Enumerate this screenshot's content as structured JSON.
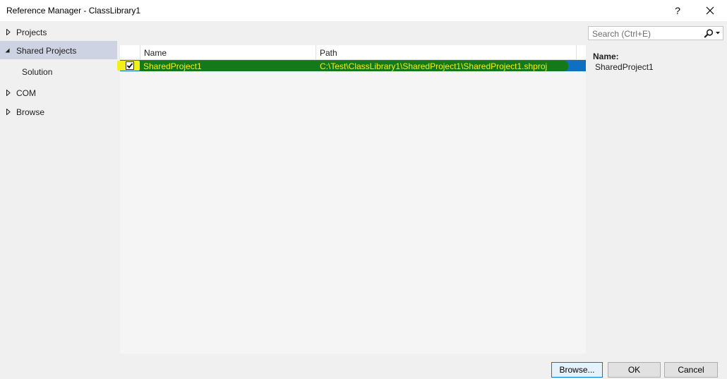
{
  "window": {
    "title": "Reference Manager - ClassLibrary1",
    "help_label": "?"
  },
  "sidebar": {
    "items": [
      {
        "label": "Projects",
        "expanded": false
      },
      {
        "label": "Shared Projects",
        "expanded": true,
        "selected": true
      },
      {
        "label": "Solution"
      },
      {
        "label": "COM",
        "expanded": false
      },
      {
        "label": "Browse",
        "expanded": false
      }
    ]
  },
  "search": {
    "placeholder": "Search (Ctrl+E)"
  },
  "table": {
    "columns": [
      "Name",
      "Path"
    ],
    "rows": [
      {
        "checked": true,
        "name": "SharedProject1",
        "path": "C:\\Test\\ClassLibrary1\\SharedProject1\\SharedProject1.shproj"
      }
    ]
  },
  "details": {
    "label": "Name:",
    "value": "SharedProject1"
  },
  "buttons": {
    "browse": "Browse...",
    "ok": "OK",
    "cancel": "Cancel"
  },
  "colors": {
    "selection": "#0e70c0",
    "highlight_green": "#137a0b",
    "highlight_yellow": "#f2ef1a",
    "nav_selected": "#cdd3e2",
    "primary_border": "#0078d7"
  }
}
